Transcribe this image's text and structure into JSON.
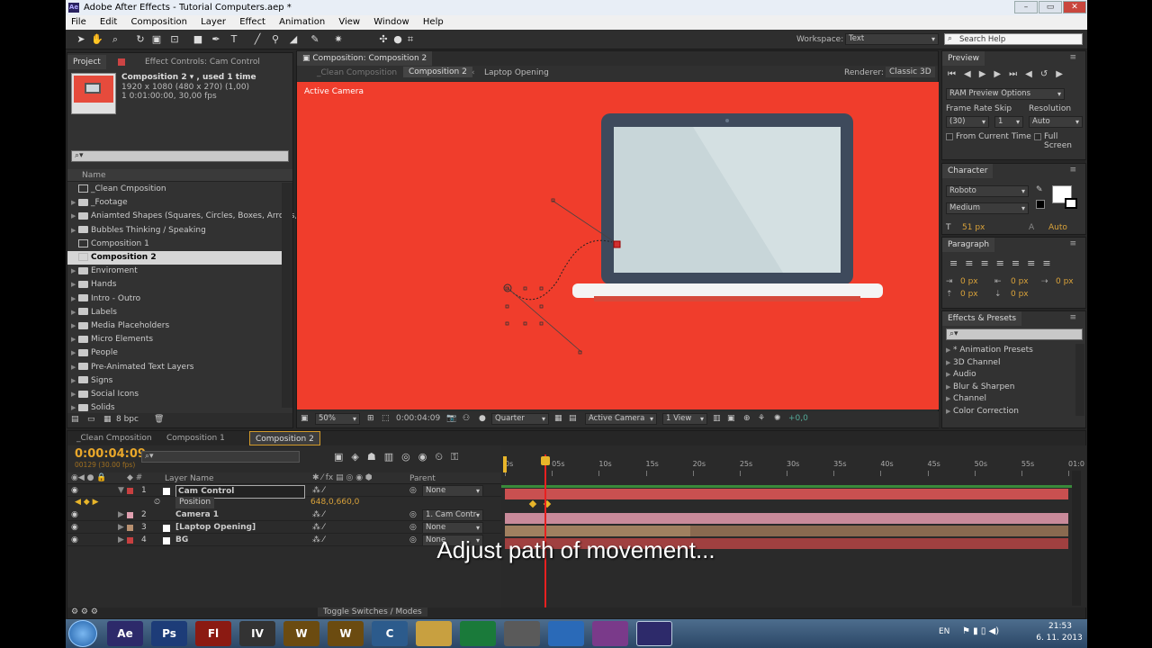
{
  "window": {
    "title": "Adobe After Effects - Tutorial Computers.aep *",
    "app_badge": "Ae",
    "min": "–",
    "max": "▭",
    "close": "✕"
  },
  "menu": [
    "File",
    "Edit",
    "Composition",
    "Layer",
    "Effect",
    "Animation",
    "View",
    "Window",
    "Help"
  ],
  "toolbar": {
    "workspace_label": "Workspace:",
    "workspace_value": "Text",
    "search_placeholder": "Search Help"
  },
  "project": {
    "tabs": [
      "Project",
      "Effect Controls: Cam Control"
    ],
    "comp_name": "Composition 2 ▾ , used 1 time",
    "comp_size": "1920 x 1080  (480 x 270) (1,00)",
    "comp_duration": "1 0:01:00:00, 30,00 fps",
    "column_name": "Name",
    "items": [
      {
        "label": "_Clean Cmposition",
        "type": "comp"
      },
      {
        "label": "_Footage",
        "type": "folder"
      },
      {
        "label": "Aniamted Shapes (Squares, Circles, Boxes, Arrows, (",
        "type": "folder"
      },
      {
        "label": "Bubbles Thinking / Speaking",
        "type": "folder"
      },
      {
        "label": "Composition 1",
        "type": "comp"
      },
      {
        "label": "Composition 2",
        "type": "comp",
        "selected": true
      },
      {
        "label": "Enviroment",
        "type": "folder"
      },
      {
        "label": "Hands",
        "type": "folder"
      },
      {
        "label": "Intro - Outro",
        "type": "folder"
      },
      {
        "label": "Labels",
        "type": "folder"
      },
      {
        "label": "Media Placeholders",
        "type": "folder"
      },
      {
        "label": "Micro Elements",
        "type": "folder"
      },
      {
        "label": "People",
        "type": "folder"
      },
      {
        "label": "Pre-Animated Text Layers",
        "type": "folder"
      },
      {
        "label": "Signs",
        "type": "folder"
      },
      {
        "label": "Social Icons",
        "type": "folder"
      },
      {
        "label": "Solids",
        "type": "folder"
      }
    ],
    "bpc": "8 bpc"
  },
  "viewer": {
    "panel_tab": "Composition: Composition 2",
    "crumbs": [
      "_Clean Composition",
      "Composition 2",
      "Laptop Opening"
    ],
    "renderer_label": "Renderer:",
    "renderer_value": "Classic 3D",
    "active_camera": "Active Camera",
    "zoom": "50%",
    "timecode": "0:00:04:09",
    "resolution": "Quarter",
    "camera": "Active Camera",
    "views": "1 View",
    "exposure": "+0,0",
    "bg_color": "#f04030"
  },
  "preview": {
    "tab": "Preview",
    "options": "RAM Preview Options",
    "frame_rate_label": "Frame Rate",
    "skip_label": "Skip",
    "resolution_label": "Resolution",
    "frame_rate": "(30)",
    "skip": "1",
    "resolution": "Auto",
    "from_current": "From Current Time",
    "full_screen": "Full Screen"
  },
  "character": {
    "tab": "Character",
    "font": "Roboto",
    "style": "Medium",
    "size": "51 px",
    "leading": "Auto"
  },
  "paragraph": {
    "tab": "Paragraph",
    "values": [
      "0 px",
      "0 px",
      "0 px",
      "0 px",
      "0 px"
    ]
  },
  "effects": {
    "tab": "Effects & Presets",
    "items": [
      "* Animation Presets",
      "3D Channel",
      "Audio",
      "Blur & Sharpen",
      "Channel",
      "Color Correction"
    ]
  },
  "timeline": {
    "tabs": [
      "_Clean Cmposition",
      "Composition 1",
      "Composition 2"
    ],
    "timecode": "0:00:04:09",
    "fps": "00129 (30.00 fps)",
    "col_layer": "Layer Name",
    "col_parent": "Parent",
    "ruler": [
      "0s",
      "05s",
      "10s",
      "15s",
      "20s",
      "25s",
      "30s",
      "35s",
      "40s",
      "45s",
      "50s",
      "55s",
      "01:0"
    ],
    "layers": [
      {
        "num": "1",
        "name": "Cam Control",
        "color": "#c84040",
        "parent": "None",
        "bar": "#c95050"
      },
      {
        "num": "2",
        "name": "Camera 1",
        "color": "#e0a0b0",
        "parent": "1. Cam Contr",
        "bar": "#c98a9a"
      },
      {
        "num": "3",
        "name": "[Laptop Opening]",
        "color": "#b89070",
        "parent": "None",
        "bar": "#8a6a50"
      },
      {
        "num": "4",
        "name": "BG",
        "color": "#c84040",
        "parent": "None",
        "bar": "#a04040"
      }
    ],
    "position_prop": "Position",
    "position_value": "648,0,660,0",
    "toggle": "Toggle Switches / Modes",
    "caption": "Adjust path of movement..."
  },
  "taskbar": {
    "lang": "EN",
    "time": "21:53",
    "date": "6. 11. 2013",
    "apps": [
      "Ae",
      "Ps",
      "Fl",
      "IV",
      "W",
      "W",
      "C",
      "",
      "",
      "",
      "",
      "",
      ""
    ]
  }
}
